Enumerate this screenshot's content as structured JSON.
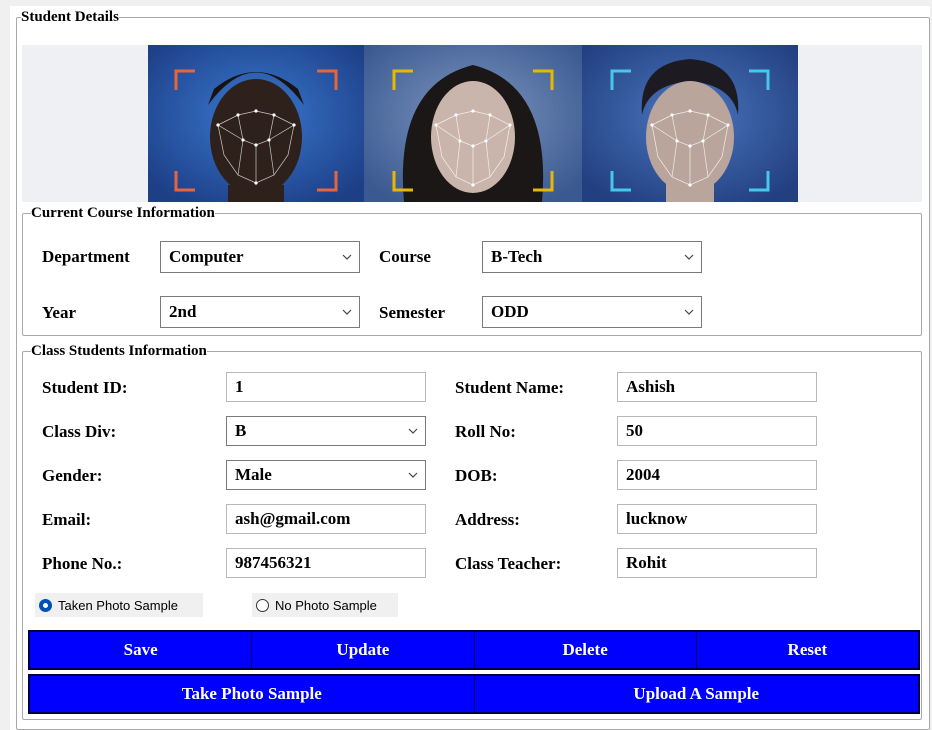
{
  "student_details": {
    "legend": "Student Details"
  },
  "photos": [
    {
      "name": "face-scan-photo-1",
      "bg": "#2a5aa8",
      "bracket": "#e8643c",
      "skin": "#3a2a24"
    },
    {
      "name": "face-scan-photo-2",
      "bg": "#4a6fa5",
      "bracket": "#e8b800",
      "skin": "#c7b3a8"
    },
    {
      "name": "face-scan-photo-3",
      "bg": "#2f5596",
      "bracket": "#46c8e8",
      "skin": "#b8a49a"
    }
  ],
  "course": {
    "legend": "Current Course Information",
    "department_label": "Department",
    "department_value": "Computer",
    "course_label": "Course",
    "course_value": "B-Tech",
    "year_label": "Year",
    "year_value": "2nd",
    "semester_label": "Semester",
    "semester_value": "ODD"
  },
  "students": {
    "legend": "Class Students Information",
    "student_id_label": "Student ID:",
    "student_id_value": "1",
    "student_name_label": "Student Name:",
    "student_name_value": "Ashish",
    "class_div_label": "Class Div:",
    "class_div_value": "B",
    "roll_no_label": "Roll No:",
    "roll_no_value": "50",
    "gender_label": "Gender:",
    "gender_value": "Male",
    "dob_label": "DOB:",
    "dob_value": "2004",
    "email_label": "Email:",
    "email_value": "ash@gmail.com",
    "address_label": "Address:",
    "address_value": "lucknow",
    "phone_label": "Phone No.:",
    "phone_value": "987456321",
    "teacher_label": "Class Teacher:",
    "teacher_value": "Rohit",
    "radio_taken": "Taken Photo Sample",
    "radio_none": "No Photo Sample"
  },
  "buttons": {
    "save": "Save",
    "update": "Update",
    "delete": "Delete",
    "reset": "Reset",
    "take_photo": "Take Photo Sample",
    "upload": "Upload A Sample"
  },
  "colors": {
    "button_blue": "#0000ff",
    "radio_selected": "#0050b8"
  }
}
